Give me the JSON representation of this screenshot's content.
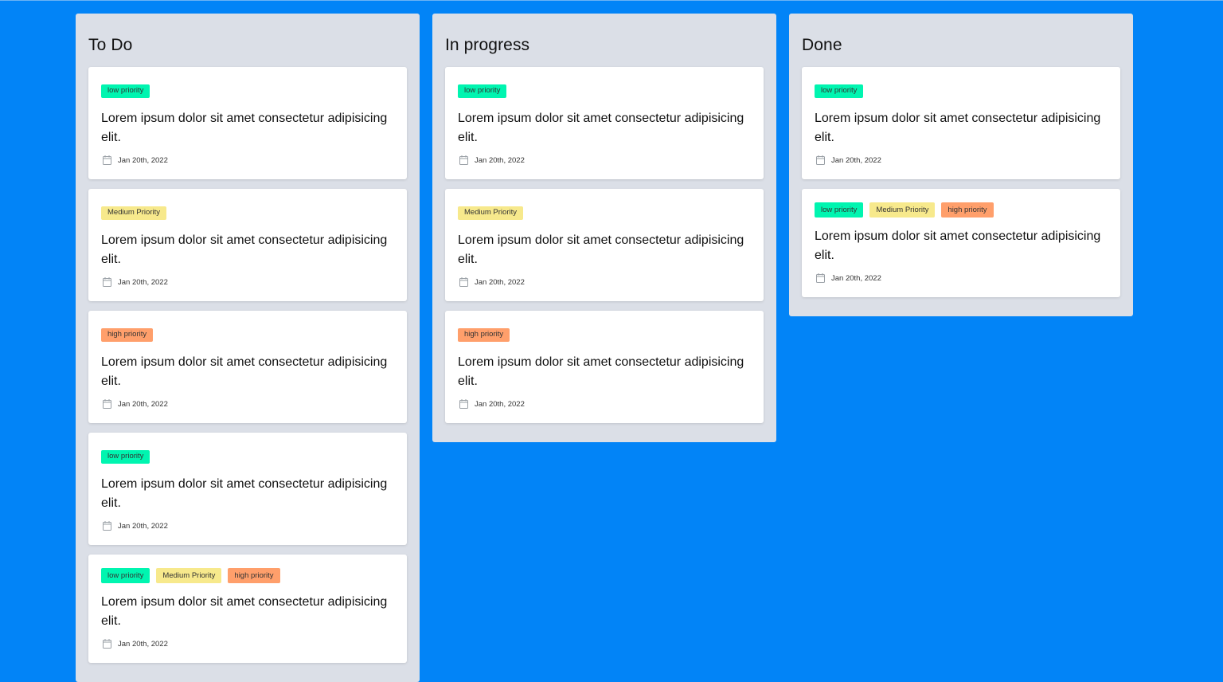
{
  "columns": [
    {
      "title": "To Do",
      "cards": [
        {
          "tags": [
            {
              "label": "low priority",
              "level": "low"
            }
          ],
          "text": "Lorem ipsum dolor sit amet consectetur adipisicing elit.",
          "date": "Jan 20th, 2022"
        },
        {
          "tags": [
            {
              "label": "Medium Priority",
              "level": "medium"
            }
          ],
          "text": "Lorem ipsum dolor sit amet consectetur adipisicing elit.",
          "date": "Jan 20th, 2022"
        },
        {
          "tags": [
            {
              "label": "high priority",
              "level": "high"
            }
          ],
          "text": "Lorem ipsum dolor sit amet consectetur adipisicing elit.",
          "date": "Jan 20th, 2022"
        },
        {
          "tags": [
            {
              "label": "low priority",
              "level": "low"
            }
          ],
          "text": "Lorem ipsum dolor sit amet consectetur adipisicing elit.",
          "date": "Jan 20th, 2022"
        },
        {
          "tags": [
            {
              "label": "low priority",
              "level": "low"
            },
            {
              "label": "Medium Priority",
              "level": "medium"
            },
            {
              "label": "high priority",
              "level": "high"
            }
          ],
          "text": "Lorem ipsum dolor sit amet consectetur adipisicing elit.",
          "date": "Jan 20th, 2022"
        }
      ]
    },
    {
      "title": "In progress",
      "cards": [
        {
          "tags": [
            {
              "label": "low priority",
              "level": "low"
            }
          ],
          "text": "Lorem ipsum dolor sit amet consectetur adipisicing elit.",
          "date": "Jan 20th, 2022"
        },
        {
          "tags": [
            {
              "label": "Medium Priority",
              "level": "medium"
            }
          ],
          "text": "Lorem ipsum dolor sit amet consectetur adipisicing elit.",
          "date": "Jan 20th, 2022"
        },
        {
          "tags": [
            {
              "label": "high priority",
              "level": "high"
            }
          ],
          "text": "Lorem ipsum dolor sit amet consectetur adipisicing elit.",
          "date": "Jan 20th, 2022"
        }
      ]
    },
    {
      "title": "Done",
      "cards": [
        {
          "tags": [
            {
              "label": "low priority",
              "level": "low"
            }
          ],
          "text": "Lorem ipsum dolor sit amet consectetur adipisicing elit.",
          "date": "Jan 20th, 2022"
        },
        {
          "tags": [
            {
              "label": "low priority",
              "level": "low"
            },
            {
              "label": "Medium Priority",
              "level": "medium"
            },
            {
              "label": "high priority",
              "level": "high"
            }
          ],
          "text": "Lorem ipsum dolor sit amet consectetur adipisicing elit.",
          "date": "Jan 20th, 2022"
        }
      ]
    }
  ],
  "icons": {
    "date": "calendar-icon"
  },
  "colors": {
    "background": "#0284f7",
    "column": "#dbdfe7",
    "low": "#00f5b0",
    "medium": "#f7e98c",
    "high": "#ff9f6b"
  }
}
